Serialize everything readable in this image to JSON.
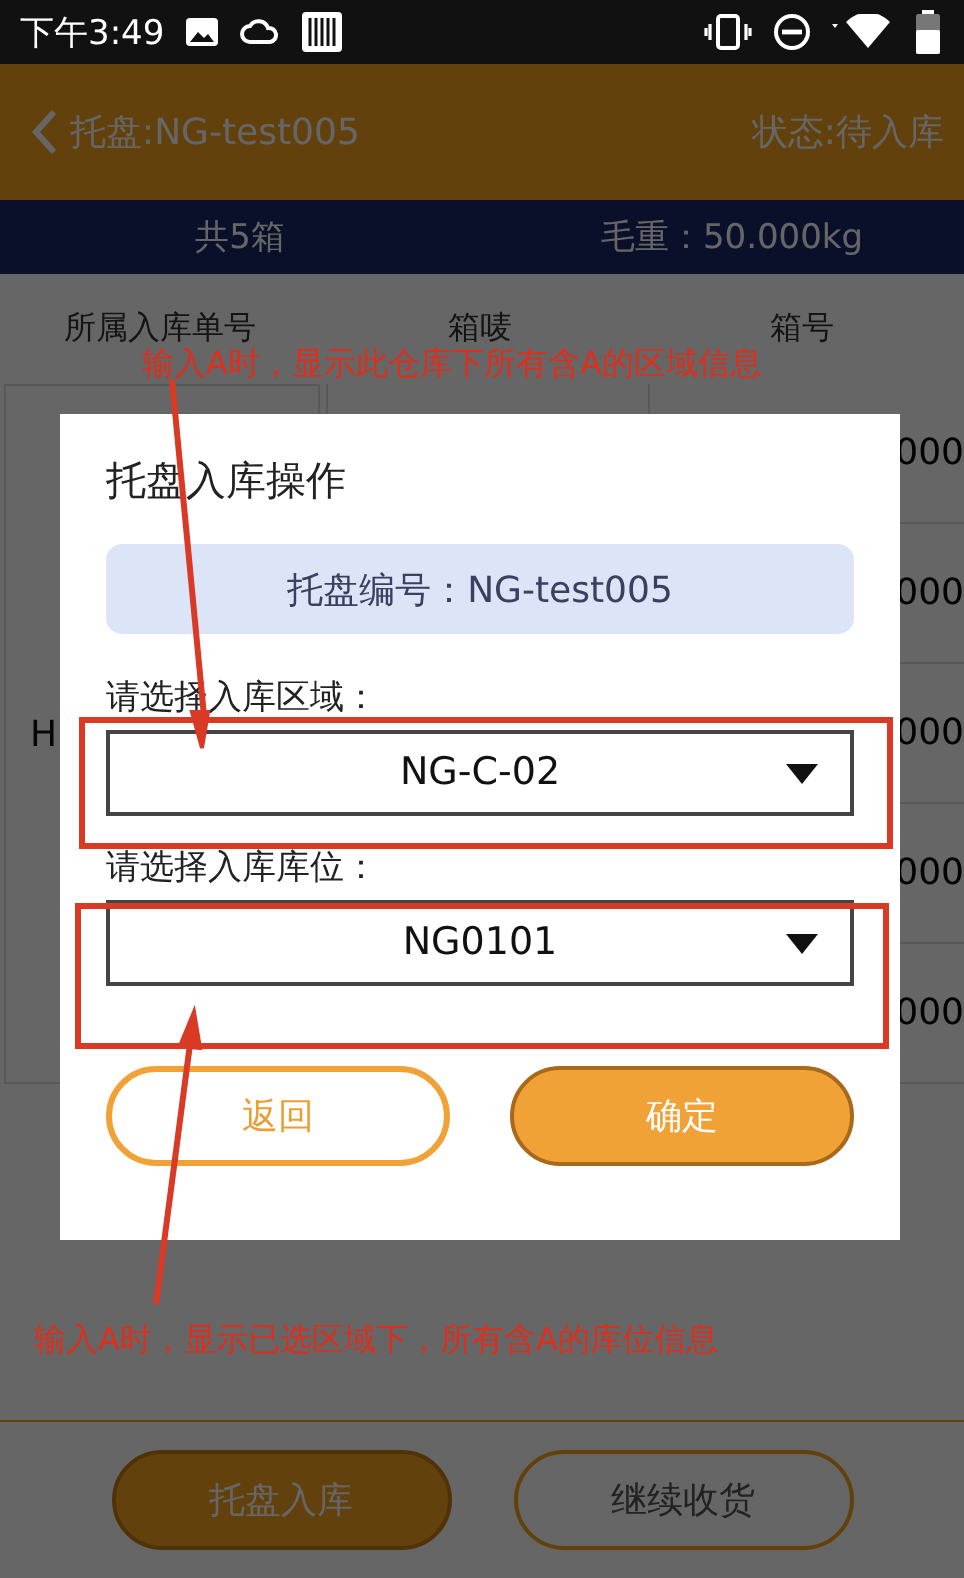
{
  "status_bar": {
    "time": "下午3:49"
  },
  "header": {
    "title": "托盘:NG-test005",
    "status": "状态:待入库"
  },
  "summary": {
    "count": "共5箱",
    "weight": "毛重：50.000kg"
  },
  "table": {
    "columns": [
      "所属入库单号",
      "箱唛",
      "箱号"
    ],
    "merged_cell": "H",
    "rows": [
      {
        "column_3": "000"
      },
      {
        "column_3": "000"
      },
      {
        "column_3": "000"
      },
      {
        "column_3": "000"
      },
      {
        "column_3": "000"
      }
    ]
  },
  "dialog": {
    "title": "托盘入库操作",
    "pallet": "托盘编号：NG-test005",
    "area_label": "请选择入库区域：",
    "area_value": "NG-C-02",
    "location_label": "请选择入库库位：",
    "location_value": "NG0101",
    "cancel": "返回",
    "confirm": "确定"
  },
  "bottom_buttons": [
    {
      "label": "托盘入库",
      "kind": "filled"
    },
    {
      "label": "继续收货",
      "kind": "outline"
    }
  ],
  "annotations": [
    "输入A时，显示此仓库下所有含A的区域信息",
    "输入A时，显示已选区域下，所有含A的库位信息"
  ]
}
